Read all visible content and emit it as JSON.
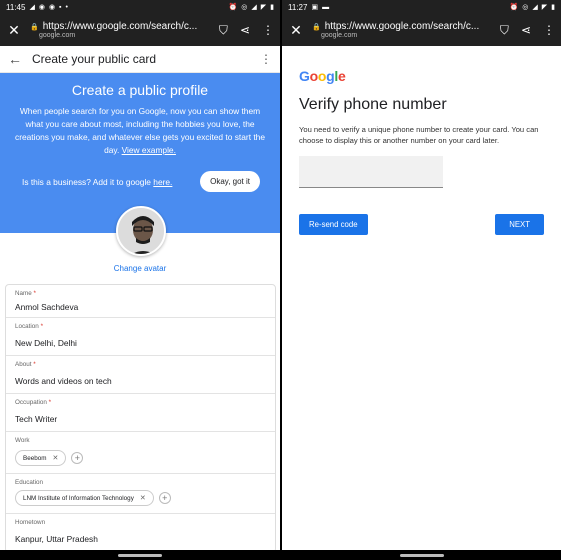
{
  "left": {
    "status_bar": {
      "time": "11:45",
      "battery": "▮"
    },
    "browser": {
      "url": "https://www.google.com/search/c...",
      "host": "google.com"
    },
    "app_bar": {
      "title": "Create your public card"
    },
    "banner": {
      "title": "Create a public profile",
      "body": "When people search for you on Google, now you can show them what you care about most, including the hobbies you love, the creations you make, and whatever else gets you excited to start the day.",
      "link": "View example.",
      "business_text": "Is this a business? Add it to google",
      "business_link": "here.",
      "okay_button": "Okay, got it"
    },
    "change_avatar": "Change avatar",
    "fields": {
      "name": {
        "label": "Name",
        "value": "Anmol Sachdeva",
        "required": "*"
      },
      "location": {
        "label": "Location",
        "value": "New Delhi, Delhi",
        "required": "*"
      },
      "about": {
        "label": "About",
        "value": "Words and videos on tech",
        "required": "*"
      },
      "occupation": {
        "label": "Occupation",
        "value": "Tech Writer",
        "required": "*"
      },
      "work": {
        "label": "Work",
        "chips": [
          "Beebom"
        ]
      },
      "education": {
        "label": "Education",
        "chips": [
          "LNM Institute of Information Technology"
        ]
      },
      "hometown": {
        "label": "Hometown",
        "value": "Kanpur, Uttar Pradesh"
      }
    }
  },
  "right": {
    "status_bar": {
      "time": "11:27"
    },
    "browser": {
      "url": "https://www.google.com/search/c...",
      "host": "google.com"
    },
    "logo": [
      "G",
      "o",
      "o",
      "g",
      "l",
      "e"
    ],
    "title": "Verify phone number",
    "description": "You need to verify a unique phone number to create your card. You can choose to display this or another number on your card later.",
    "resend_button": "Re-send code",
    "next_button": "NEXT"
  },
  "colors": {
    "banner": "#4a8cf0",
    "accent": "#1a73e8"
  }
}
